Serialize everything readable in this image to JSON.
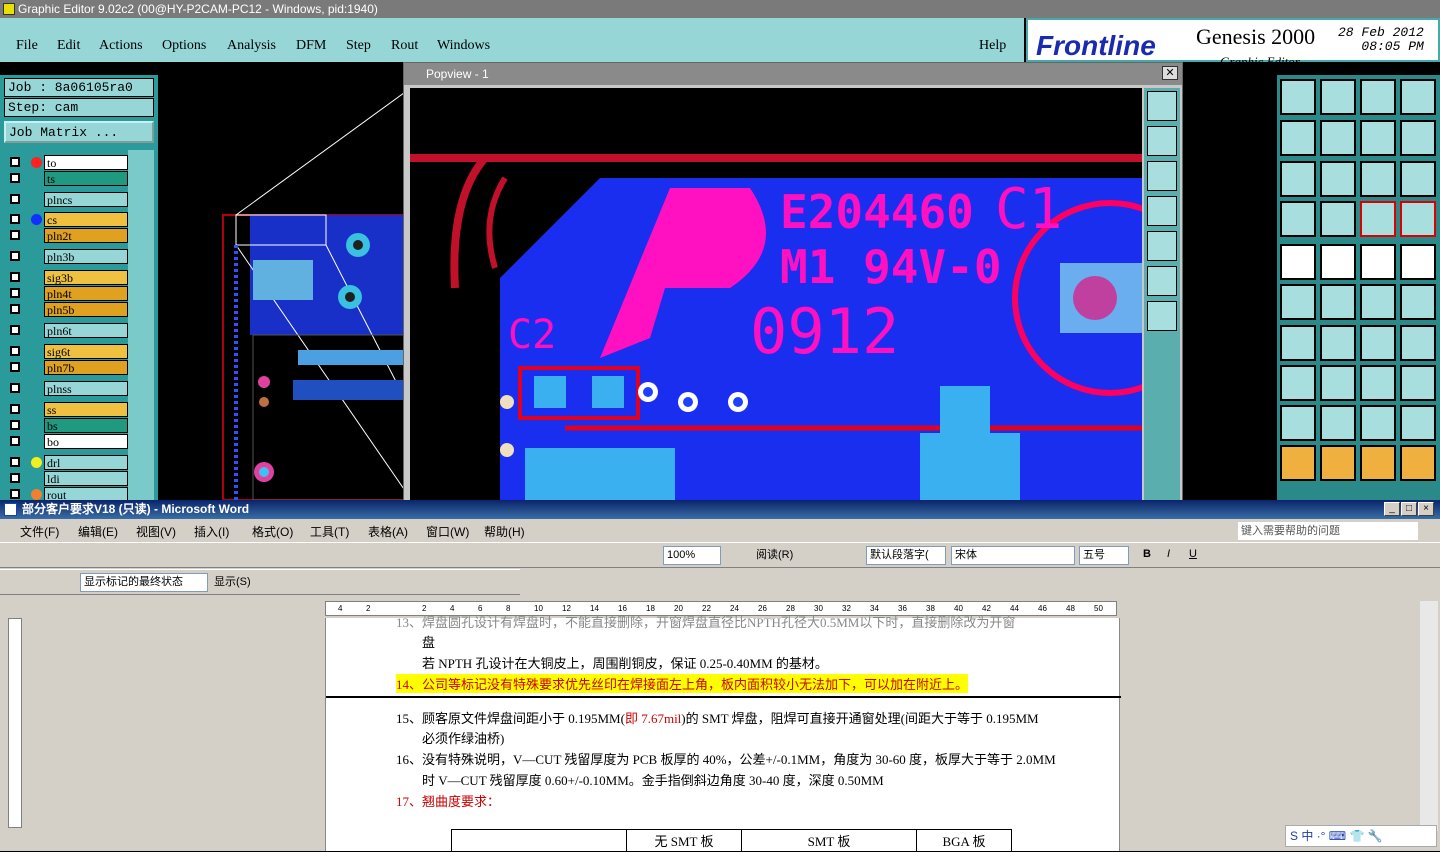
{
  "titlebar": {
    "title": "Graphic Editor 9.02c2 (00@HY-P2CAM-PC12 - Windows, pid:1940)"
  },
  "menu": {
    "items": [
      "File",
      "Edit",
      "Actions",
      "Options",
      "Analysis",
      "DFM",
      "Step",
      "Rout",
      "Windows"
    ],
    "help": "Help"
  },
  "brand": {
    "logo": "Frontline",
    "product": "Genesis 2000",
    "subtitle": "Graphic Editor",
    "date": "28 Feb 2012",
    "time": "08:05 PM"
  },
  "job": {
    "job_line": "Job : 8a06105ra0",
    "step_line": "Step: cam",
    "matrix_button": "Job Matrix ..."
  },
  "layers": [
    {
      "name": "to",
      "color": "#ffffff",
      "dot": "#ff2020",
      "dot2": "#0000cc"
    },
    {
      "name": "ts",
      "color": "#1f9a80",
      "dot": ""
    },
    {
      "name": "plncs",
      "color": "#96d6d6",
      "dot": ""
    },
    {
      "name": "cs",
      "color": "#f0c040",
      "dot": "#1030ff"
    },
    {
      "name": "pln2t",
      "color": "#e0a020",
      "dot": ""
    },
    {
      "name": "pln3b",
      "color": "#96d6d6",
      "dot": ""
    },
    {
      "name": "sig3b",
      "color": "#f0c040",
      "dot": ""
    },
    {
      "name": "pln4t",
      "color": "#e0a020",
      "dot": ""
    },
    {
      "name": "pln5b",
      "color": "#e0a020",
      "dot": ""
    },
    {
      "name": "pln6t",
      "color": "#96d6d6",
      "dot": ""
    },
    {
      "name": "sig6t",
      "color": "#f0c040",
      "dot": ""
    },
    {
      "name": "pln7b",
      "color": "#e0a020",
      "dot": ""
    },
    {
      "name": "plnss",
      "color": "#96d6d6",
      "dot": ""
    },
    {
      "name": "ss",
      "color": "#f0c040",
      "dot": ""
    },
    {
      "name": "bs",
      "color": "#1f9a80",
      "dot": ""
    },
    {
      "name": "bo",
      "color": "#ffffff",
      "dot": ""
    },
    {
      "name": "drl",
      "color": "#96d6d6",
      "dot": "#f0f020"
    },
    {
      "name": "ldi",
      "color": "#96d6d6",
      "dot": ""
    },
    {
      "name": "rout",
      "color": "#96d6d6",
      "dot": "#f08030"
    }
  ],
  "popview": {
    "title": "Popview - 1",
    "close": "✕",
    "silk": {
      "line1": "E204460",
      "line2": "M1 94V-0",
      "date": "0912",
      "c1": "C1",
      "c2": "C2"
    }
  },
  "word": {
    "title": "部分客户要求V18 (只读) - Microsoft Word",
    "menu": [
      "文件(F)",
      "编辑(E)",
      "视图(V)",
      "插入(I)",
      "格式(O)",
      "工具(T)",
      "表格(A)",
      "窗口(W)",
      "帮助(H)"
    ],
    "help_placeholder": "键入需要帮助的问题",
    "zoom": "100%",
    "read_button": "阅读(R)",
    "style": "默认段落字(",
    "font": "宋体",
    "size": "五号",
    "markup_state": "显示标记的最终状态",
    "show_menu": "显示(S)",
    "ruler_nums": [
      "4",
      "2",
      "",
      "2",
      "4",
      "6",
      "8",
      "10",
      "12",
      "14",
      "16",
      "18",
      "20",
      "22",
      "24",
      "26",
      "28",
      "30",
      "32",
      "34",
      "36",
      "38",
      "40",
      "42",
      "44",
      "46",
      "48",
      "50"
    ],
    "lines": {
      "l0": "13、焊盘圆孔设计有焊盘时，不能直接删除，开窗焊盘直径比NPTH孔径大0.5MM以下时，直接删除改为开窗",
      "l0b": "盘",
      "l1": "若 NPTH 孔设计在大铜皮上，周围削铜皮，保证 0.25-0.40MM 的基材。",
      "l2": "14、公司等标记没有特殊要求优先丝印在焊接面左上角，板内面积较小无法加下，可以加在附近上。",
      "l3a": "15、顾客原文件焊盘间距小于 0.195MM(",
      "l3b": "即 7.67mil",
      "l3c": ")的 SMT 焊盘，阻焊可直接开通窗处理(间距大于等于 0.195MM",
      "l4": "必须作绿油桥)",
      "l5": "16、没有特殊说明，V—CUT 残留厚度为 PCB 板厚的 40%，公差+/-0.1MM，角度为 30-60 度，板厚大于等于 2.0MM",
      "l6": "时 V—CUT 残留厚度 0.60+/-0.10MM。金手指倒斜边角度 30-40 度，深度 0.50MM",
      "l7": "17、翘曲度要求："
    },
    "table_headers": [
      "",
      "无 SMT 板",
      "SMT 板",
      "BGA 板"
    ],
    "ime": "S 中 ·° ⌨ 👕 🔧"
  }
}
